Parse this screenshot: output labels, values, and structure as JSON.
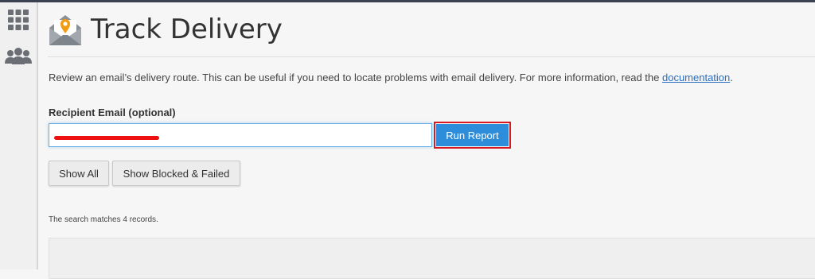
{
  "page": {
    "title": "Track Delivery",
    "description_prefix": "Review an email’s delivery route. This can be useful if you need to locate problems with email delivery. For more information, read the ",
    "documentation_link": "documentation",
    "description_suffix": "."
  },
  "form": {
    "recipient_label": "Recipient Email (optional)",
    "recipient_value": "",
    "run_report_label": "Run Report"
  },
  "filters": {
    "show_all_label": "Show All",
    "show_blocked_label": "Show Blocked & Failed"
  },
  "results": {
    "match_text": "The search matches 4 records."
  },
  "sidebar": {
    "icons": [
      "grid-apps-icon",
      "users-group-icon"
    ]
  },
  "colors": {
    "accent": "#2d8ddb",
    "highlight_outline": "#d71922",
    "redaction": "#ee1111",
    "logo_pin": "#f39c12"
  }
}
